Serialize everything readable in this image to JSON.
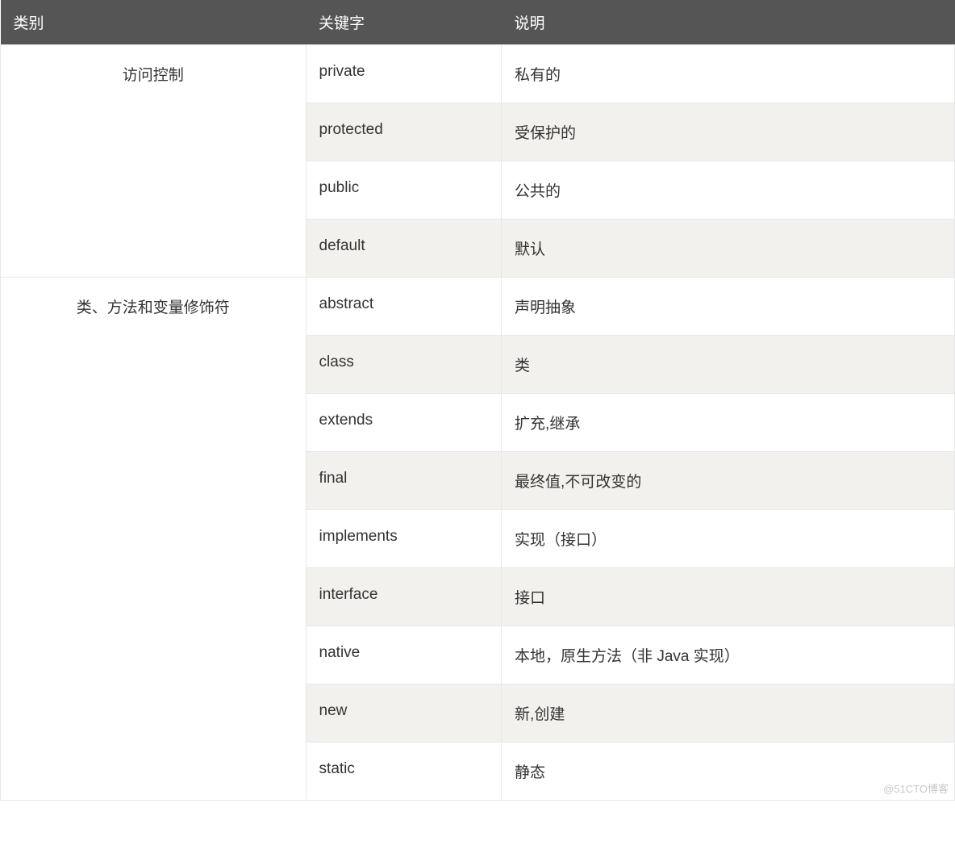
{
  "headers": {
    "category": "类别",
    "keyword": "关键字",
    "description": "说明"
  },
  "groups": [
    {
      "category": "访问控制",
      "rows": [
        {
          "keyword": "private",
          "description": "私有的"
        },
        {
          "keyword": "protected",
          "description": "受保护的"
        },
        {
          "keyword": "public",
          "description": "公共的"
        },
        {
          "keyword": "default",
          "description": "默认"
        }
      ]
    },
    {
      "category": "类、方法和变量修饰符",
      "rows": [
        {
          "keyword": "abstract",
          "description": "声明抽象"
        },
        {
          "keyword": "class",
          "description": "类"
        },
        {
          "keyword": "extends",
          "description": "扩充,继承"
        },
        {
          "keyword": "final",
          "description": "最终值,不可改变的"
        },
        {
          "keyword": "implements",
          "description": "实现（接口）"
        },
        {
          "keyword": "interface",
          "description": "接口"
        },
        {
          "keyword": "native",
          "description": "本地，原生方法（非 Java 实现）"
        },
        {
          "keyword": "new",
          "description": "新,创建"
        },
        {
          "keyword": "static",
          "description": "静态"
        }
      ]
    }
  ],
  "watermark": "@51CTO博客"
}
